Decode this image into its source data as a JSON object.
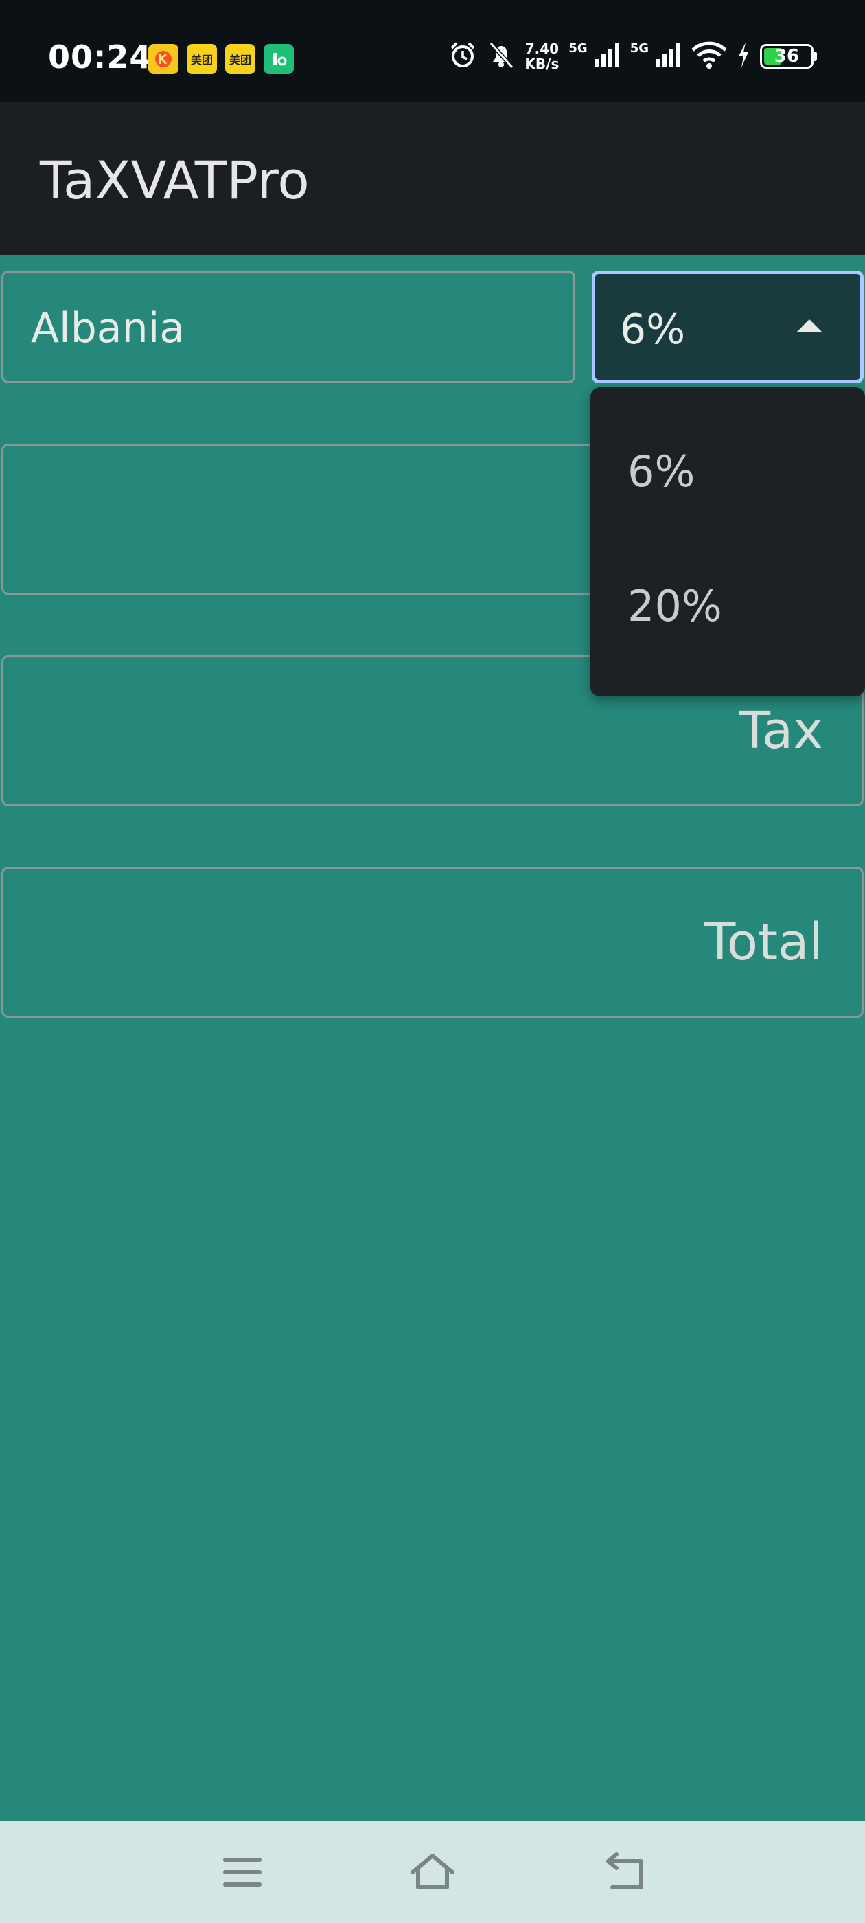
{
  "status_bar": {
    "time": "00:24",
    "notifications": [
      {
        "icon": "kuaishou-icon",
        "color": "#f4c81d"
      },
      {
        "icon": "meituan-icon",
        "label": "美团",
        "color": "#f7d21b"
      },
      {
        "icon": "meituan-waimai-icon",
        "label": "美团",
        "color": "#f7d21b"
      },
      {
        "icon": "app-green-icon",
        "color": "#1fbf78"
      }
    ],
    "net_speed_value": "7.40",
    "net_speed_unit": "KB/s",
    "signal_1_label": "5G",
    "signal_2_label": "5G",
    "battery_level": "36",
    "battery_color": "#2fd34a"
  },
  "app_bar": {
    "title": "TaXVATPro"
  },
  "form": {
    "country": "Albania",
    "vat_selected": "6%",
    "amount_label": "",
    "tax_label": "Tax",
    "total_label": "Total"
  },
  "dropdown": {
    "options": [
      "6%",
      "20%"
    ]
  },
  "colors": {
    "background": "#26877b",
    "app_bar": "#1b1f23",
    "status_bar": "#0b1115",
    "focus_border": "#aac8ff",
    "nav_bar": "#d4e6e4"
  }
}
